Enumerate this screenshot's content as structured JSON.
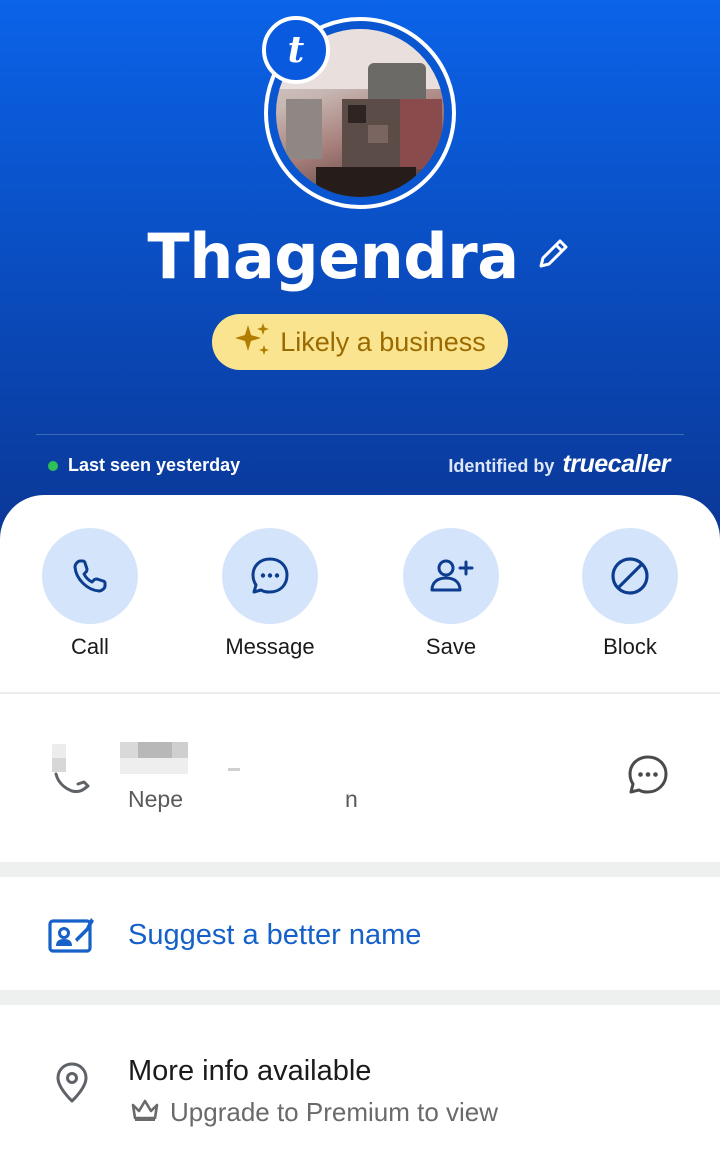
{
  "profile": {
    "name": "Thagendra",
    "tag": "Likely a business",
    "last_seen": "Last seen yesterday",
    "identified_by": "Identified by",
    "brand": "truecaller"
  },
  "actions": [
    {
      "label": "Call",
      "icon": "phone-icon"
    },
    {
      "label": "Message",
      "icon": "chat-bubble-icon"
    },
    {
      "label": "Save",
      "icon": "add-person-icon"
    },
    {
      "label": "Block",
      "icon": "block-icon"
    }
  ],
  "phone": {
    "country_partial": "Nepe",
    "country_tail": "n"
  },
  "suggest": {
    "label": "Suggest a better name"
  },
  "more_info": {
    "title": "More info available",
    "subtitle": "Upgrade to Premium to view"
  },
  "colors": {
    "header_top": "#0b63e8",
    "header_bottom": "#0a3796",
    "accent_blue": "#1560c9",
    "action_bg": "#d4e5fb",
    "pill_bg": "#fbe48f",
    "pill_text": "#9a6a00"
  }
}
